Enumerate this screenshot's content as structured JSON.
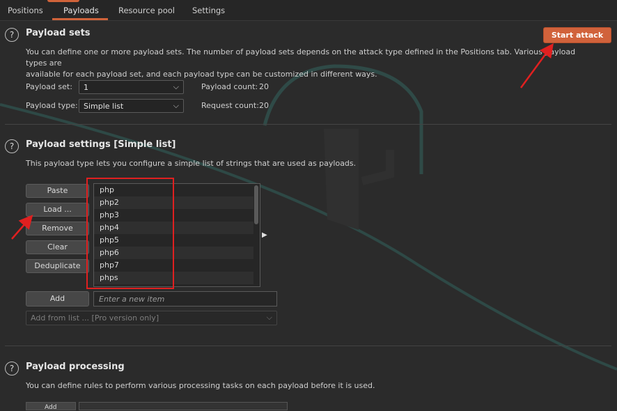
{
  "tabs": [
    {
      "label": "Positions"
    },
    {
      "label": "Payloads"
    },
    {
      "label": "Resource pool"
    },
    {
      "label": "Settings"
    }
  ],
  "payload_sets": {
    "title": "Payload sets",
    "description_line1": "You can define one or more payload sets. The number of payload sets depends on the attack type defined in the Positions tab. Various payload types are",
    "description_line2": "available for each payload set, and each payload type can be customized in different ways.",
    "start_attack_label": "Start attack",
    "payload_set_label": "Payload set:",
    "payload_set_value": "1",
    "payload_type_label": "Payload type:",
    "payload_type_value": "Simple list",
    "payload_count_label": "Payload count:",
    "payload_count_value": "20",
    "request_count_label": "Request count:",
    "request_count_value": "20"
  },
  "payload_settings": {
    "title": "Payload settings [Simple list]",
    "description": "This payload type lets you configure a simple list of strings that are used as payloads.",
    "buttons": {
      "paste": "Paste",
      "load": "Load ...",
      "remove": "Remove",
      "clear": "Clear",
      "deduplicate": "Deduplicate",
      "add": "Add"
    },
    "items": [
      "php",
      "php2",
      "php3",
      "php4",
      "php5",
      "php6",
      "php7",
      "phps"
    ],
    "new_item_placeholder": "Enter a new item",
    "add_from_list": "Add from list ... [Pro version only]"
  },
  "payload_processing": {
    "title": "Payload processing",
    "description": "You can define rules to perform various processing tasks on each payload before it is used.",
    "add_label": "Add"
  },
  "colors": {
    "accent": "#d1623b",
    "background": "#2b2b2b",
    "annotation": "#e02020"
  }
}
